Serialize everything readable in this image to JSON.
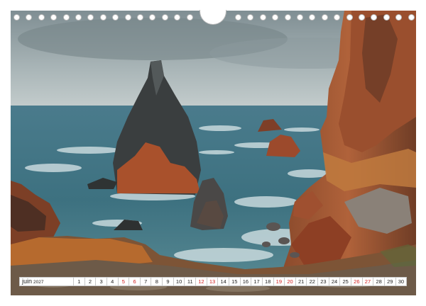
{
  "calendar": {
    "month": "juin",
    "year": "2027",
    "days": [
      {
        "n": "1",
        "we": false
      },
      {
        "n": "2",
        "we": false
      },
      {
        "n": "3",
        "we": false
      },
      {
        "n": "4",
        "we": false
      },
      {
        "n": "5",
        "we": true
      },
      {
        "n": "6",
        "we": true
      },
      {
        "n": "7",
        "we": false
      },
      {
        "n": "8",
        "we": false
      },
      {
        "n": "9",
        "we": false
      },
      {
        "n": "10",
        "we": false
      },
      {
        "n": "11",
        "we": false
      },
      {
        "n": "12",
        "we": true
      },
      {
        "n": "13",
        "we": true
      },
      {
        "n": "14",
        "we": false
      },
      {
        "n": "15",
        "we": false
      },
      {
        "n": "16",
        "we": false
      },
      {
        "n": "17",
        "we": false
      },
      {
        "n": "18",
        "we": false
      },
      {
        "n": "19",
        "we": true
      },
      {
        "n": "20",
        "we": true
      },
      {
        "n": "21",
        "we": false
      },
      {
        "n": "22",
        "we": false
      },
      {
        "n": "23",
        "we": false
      },
      {
        "n": "24",
        "we": false
      },
      {
        "n": "25",
        "we": false
      },
      {
        "n": "26",
        "we": true
      },
      {
        "n": "27",
        "we": true
      },
      {
        "n": "28",
        "we": false
      },
      {
        "n": "29",
        "we": false
      },
      {
        "n": "30",
        "we": false
      }
    ]
  },
  "colors": {
    "weekend": "#d21f1f",
    "sky": "#8f9ea3",
    "sea": "#3f7283",
    "rock_red": "#a4502c",
    "rock_dark": "#3c3f3f"
  },
  "image_subject": "coastal-sea-stacks-photo"
}
